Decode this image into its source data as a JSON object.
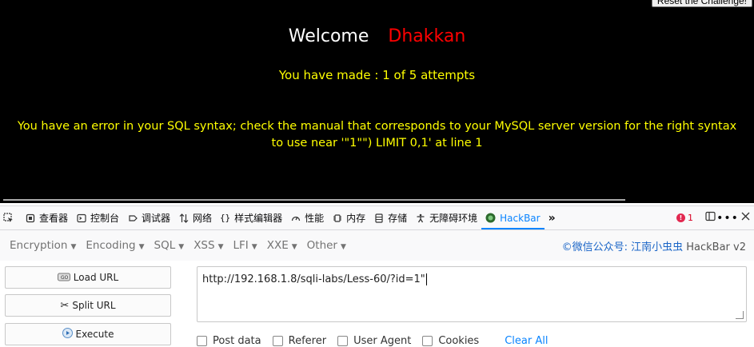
{
  "page": {
    "reset_button": "Reset the Challenge!",
    "welcome": "Welcome",
    "username": "Dhakkan",
    "attempts": "You have made : 1 of 5 attempts",
    "error_line1": "You have an error in your SQL syntax; check the manual that corresponds to your MySQL server version for the right syntax",
    "error_line2": "to use near '\"1\"\") LIMIT 0,1' at line 1"
  },
  "devtools": {
    "tabs": [
      {
        "label": "查看器",
        "icon": "inspector-icon"
      },
      {
        "label": "控制台",
        "icon": "console-icon"
      },
      {
        "label": "调试器",
        "icon": "debugger-icon"
      },
      {
        "label": "网络",
        "icon": "network-icon"
      },
      {
        "label": "样式编辑器",
        "icon": "style-editor-icon"
      },
      {
        "label": "性能",
        "icon": "performance-icon"
      },
      {
        "label": "内存",
        "icon": "memory-icon"
      },
      {
        "label": "存储",
        "icon": "storage-icon"
      },
      {
        "label": "无障碍环境",
        "icon": "accessibility-icon"
      },
      {
        "label": "HackBar",
        "icon": "hackbar-icon"
      }
    ],
    "error_count": "1"
  },
  "hackbar": {
    "menu": [
      "Encryption",
      "Encoding",
      "SQL",
      "XSS",
      "LFI",
      "XXE",
      "Other"
    ],
    "brand_prefix": "©微信公众号:",
    "brand_name": "江南小虫虫",
    "brand_suffix": "HackBar v2",
    "load_url": "Load URL",
    "split_url": "Split URL",
    "execute": "Execute",
    "url_value": "http://192.168.1.8/sqli-labs/Less-60/?id=1\"",
    "options": [
      "Post data",
      "Referer",
      "User Agent",
      "Cookies"
    ],
    "clear_all": "Clear All"
  }
}
